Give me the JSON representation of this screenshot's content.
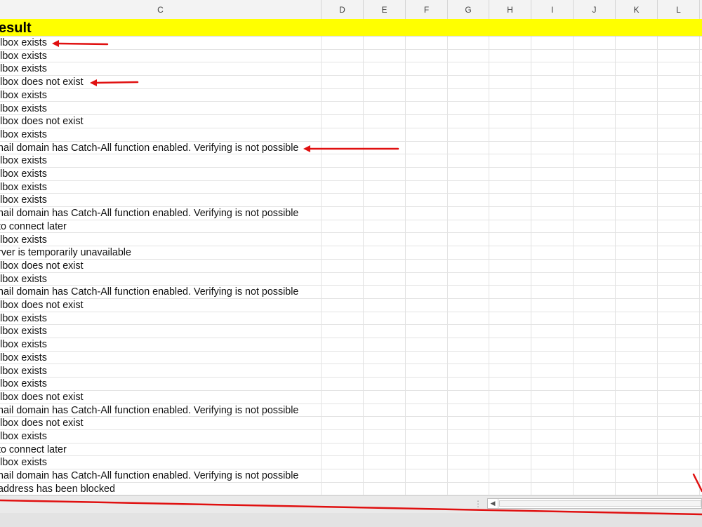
{
  "sheet": {
    "columns": [
      "C",
      "D",
      "E",
      "F",
      "G",
      "H",
      "I",
      "J",
      "K",
      "L"
    ],
    "header_title": "esult",
    "rows": [
      "ilbox exists",
      "ilbox exists",
      "ilbox exists",
      "ilbox does not exist",
      "ilbox exists",
      "ilbox exists",
      "ilbox does not exist",
      "ilbox exists",
      "nail domain has Catch-All function enabled. Verifying is not possible",
      "ilbox exists",
      "ilbox exists",
      "ilbox exists",
      "ilbox exists",
      "nail domain has Catch-All function enabled. Verifying is not possible",
      " to connect later",
      "ilbox exists",
      "rver is temporarily unavailable",
      "ilbox does not exist",
      "ilbox exists",
      "nail domain has Catch-All function enabled. Verifying is not possible",
      "ilbox does not exist",
      "ilbox exists",
      "ilbox exists",
      "ilbox exists",
      "ilbox exists",
      "ilbox exists",
      "ilbox exists",
      "ilbox does not exist",
      "nail domain has Catch-All function enabled. Verifying is not possible",
      "ilbox does not exist",
      "ilbox exists",
      " to connect later",
      "ilbox exists",
      "nail domain has Catch-All function enabled. Verifying is not possible",
      "address has been blocked"
    ]
  },
  "colors": {
    "header_fill": "#ffff00",
    "annotation_arrow": "#e01010",
    "gridline": "#e3e3e3"
  },
  "icons": {
    "scroll_left": "triangle-left",
    "split_grip": "vertical-dots"
  }
}
